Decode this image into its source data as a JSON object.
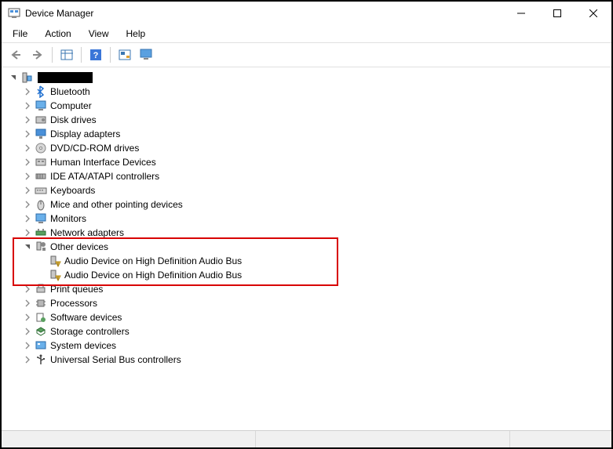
{
  "window": {
    "title": "Device Manager"
  },
  "menu": {
    "file": "File",
    "action": "Action",
    "view": "View",
    "help": "Help"
  },
  "tree": {
    "root_label": "",
    "categories": [
      {
        "label": "Bluetooth",
        "icon": "bluetooth-icon"
      },
      {
        "label": "Computer",
        "icon": "computer-icon"
      },
      {
        "label": "Disk drives",
        "icon": "disk-icon"
      },
      {
        "label": "Display adapters",
        "icon": "display-icon"
      },
      {
        "label": "DVD/CD-ROM drives",
        "icon": "cdrom-icon"
      },
      {
        "label": "Human Interface Devices",
        "icon": "hid-icon"
      },
      {
        "label": "IDE ATA/ATAPI controllers",
        "icon": "ide-icon"
      },
      {
        "label": "Keyboards",
        "icon": "keyboard-icon"
      },
      {
        "label": "Mice and other pointing devices",
        "icon": "mouse-icon"
      },
      {
        "label": "Monitors",
        "icon": "monitor-icon"
      },
      {
        "label": "Network adapters",
        "icon": "network-icon"
      }
    ],
    "other_devices": {
      "label": "Other devices",
      "children": [
        {
          "label": "Audio Device on High Definition Audio Bus",
          "icon": "unknown-device-icon"
        },
        {
          "label": "Audio Device on High Definition Audio Bus",
          "icon": "unknown-device-icon"
        }
      ]
    },
    "categories_after": [
      {
        "label": "Print queues",
        "icon": "printer-icon"
      },
      {
        "label": "Processors",
        "icon": "processor-icon"
      },
      {
        "label": "Software devices",
        "icon": "software-icon"
      },
      {
        "label": "Storage controllers",
        "icon": "storage-icon"
      },
      {
        "label": "System devices",
        "icon": "system-icon"
      },
      {
        "label": "Universal Serial Bus controllers",
        "icon": "usb-icon"
      }
    ]
  }
}
